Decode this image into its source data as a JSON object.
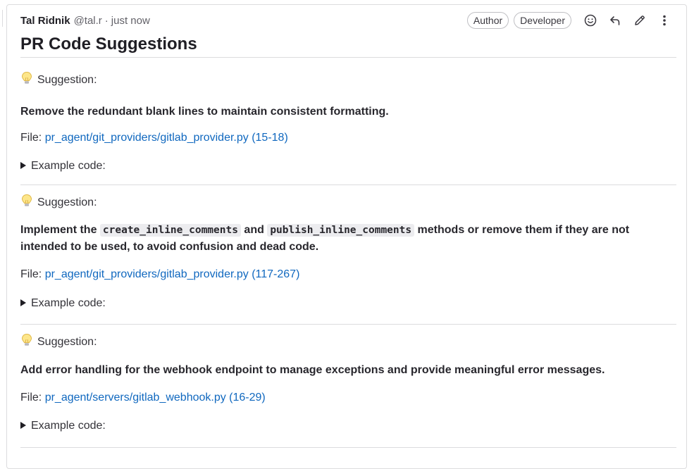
{
  "header": {
    "author_name": "Tal Ridnik",
    "author_handle": "@tal.r",
    "separator": "·",
    "time": "just now",
    "badges": [
      "Author",
      "Developer"
    ],
    "icons": [
      "smiley-icon",
      "reply-icon",
      "pencil-icon",
      "more-vertical-icon"
    ]
  },
  "title": "PR Code Suggestions",
  "suggestions": [
    {
      "heading": "Suggestion:",
      "description": "Remove the redundant blank lines to maintain consistent formatting.",
      "file_label": "File:",
      "file_link": "pr_agent/git_providers/gitlab_provider.py (15-18)",
      "example_label": "Example code:"
    },
    {
      "heading": "Suggestion:",
      "description_parts": [
        "Implement the ",
        "create_inline_comments",
        " and ",
        "publish_inline_comments",
        " methods or remove them if they are not intended to be used, to avoid confusion and dead code."
      ],
      "file_label": "File:",
      "file_link": "pr_agent/git_providers/gitlab_provider.py (117-267)",
      "example_label": "Example code:"
    },
    {
      "heading": "Suggestion:",
      "description": "Add error handling for the webhook endpoint to manage exceptions and provide meaningful error messages.",
      "file_label": "File:",
      "file_link": "pr_agent/servers/gitlab_webhook.py (16-29)",
      "example_label": "Example code:"
    }
  ],
  "colors": {
    "link": "#1068bf",
    "border": "#dcdcde",
    "text": "#333238",
    "code_bg": "#ececef"
  }
}
